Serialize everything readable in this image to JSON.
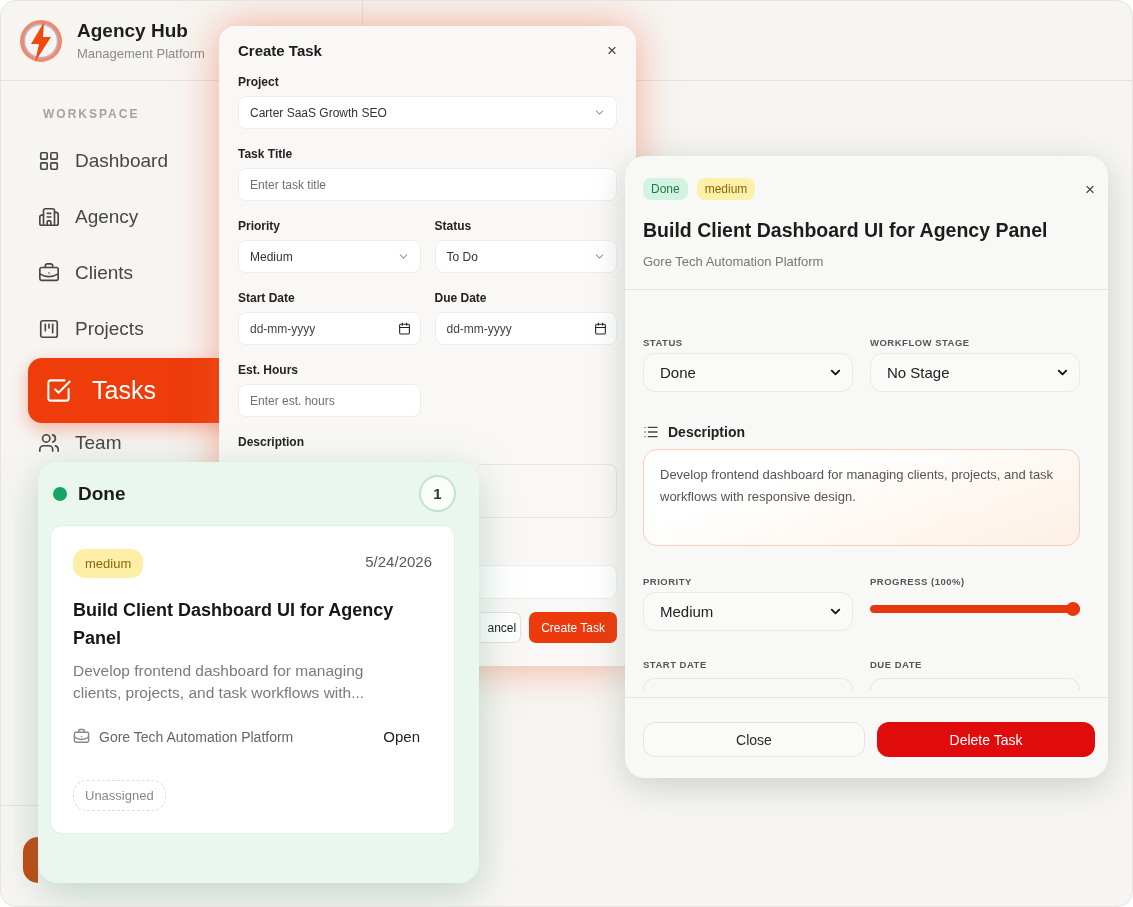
{
  "sidebar": {
    "brand": {
      "name": "Agency Hub",
      "tagline": "Management Platform"
    },
    "section_label": "WORKSPACE",
    "items": [
      {
        "label": "Dashboard",
        "selected": false
      },
      {
        "label": "Agency",
        "selected": false
      },
      {
        "label": "Clients",
        "selected": false
      },
      {
        "label": "Projects",
        "selected": false
      },
      {
        "label": "Tasks",
        "selected": true
      },
      {
        "label": "Team",
        "selected": false
      }
    ]
  },
  "create_task_dialog": {
    "title": "Create Task",
    "close": "×",
    "fields": [
      {
        "kind": "select",
        "label": "Project",
        "value": "Carter SaaS Growth SEO"
      },
      {
        "kind": "input",
        "label": "Task Title",
        "placeholder": "Enter task title"
      },
      {
        "kind": "select",
        "label": "Priority",
        "value": "Medium"
      },
      {
        "kind": "select",
        "label": "Status",
        "value": "To Do"
      },
      {
        "kind": "date",
        "label": "Start Date",
        "placeholder": "dd-mm-yyyy"
      },
      {
        "kind": "date",
        "label": "Due Date",
        "placeholder": "dd-mm-yyyy"
      },
      {
        "kind": "input",
        "label": "Est. Hours",
        "placeholder": "Enter est. hours"
      },
      {
        "kind": "textarea",
        "label": "Description"
      }
    ],
    "buttons": [
      {
        "kind": "secondary",
        "label": "ancel"
      },
      {
        "kind": "primary",
        "label": "Create Task"
      }
    ]
  },
  "done_column": {
    "title": "Done",
    "count": "1",
    "cards": [
      {
        "priority": "medium",
        "date": "5/24/2026",
        "title": "Build Client Dashboard UI for Agency Panel",
        "description": "Develop frontend dashboard for managing clients, projects, and task workflows with...",
        "project": "Gore Tech Automation Platform",
        "action": "Open",
        "assignee": "Unassigned"
      }
    ]
  },
  "task_detail": {
    "badges": [
      {
        "kind": "status",
        "label": "Done"
      },
      {
        "kind": "priority",
        "label": "medium"
      }
    ],
    "close": "×",
    "title": "Build Client Dashboard UI for Agency Panel",
    "project": "Gore Tech Automation Platform",
    "selects": [
      {
        "label": "STATUS",
        "value": "Done"
      },
      {
        "label": "WORKFLOW STAGE",
        "value": "No Stage"
      }
    ],
    "description_heading": "Description",
    "description": "Develop frontend dashboard for managing clients, projects, and task workflows with responsive design.",
    "priority": {
      "label": "PRIORITY",
      "value": "Medium"
    },
    "progress": {
      "label": "PROGRESS (100%)",
      "level": 1
    },
    "date_labels": [
      "START DATE",
      "DUE DATE"
    ],
    "buttons": [
      {
        "kind": "secondary",
        "label": "Close"
      },
      {
        "kind": "danger",
        "label": "Delete Task"
      }
    ]
  }
}
